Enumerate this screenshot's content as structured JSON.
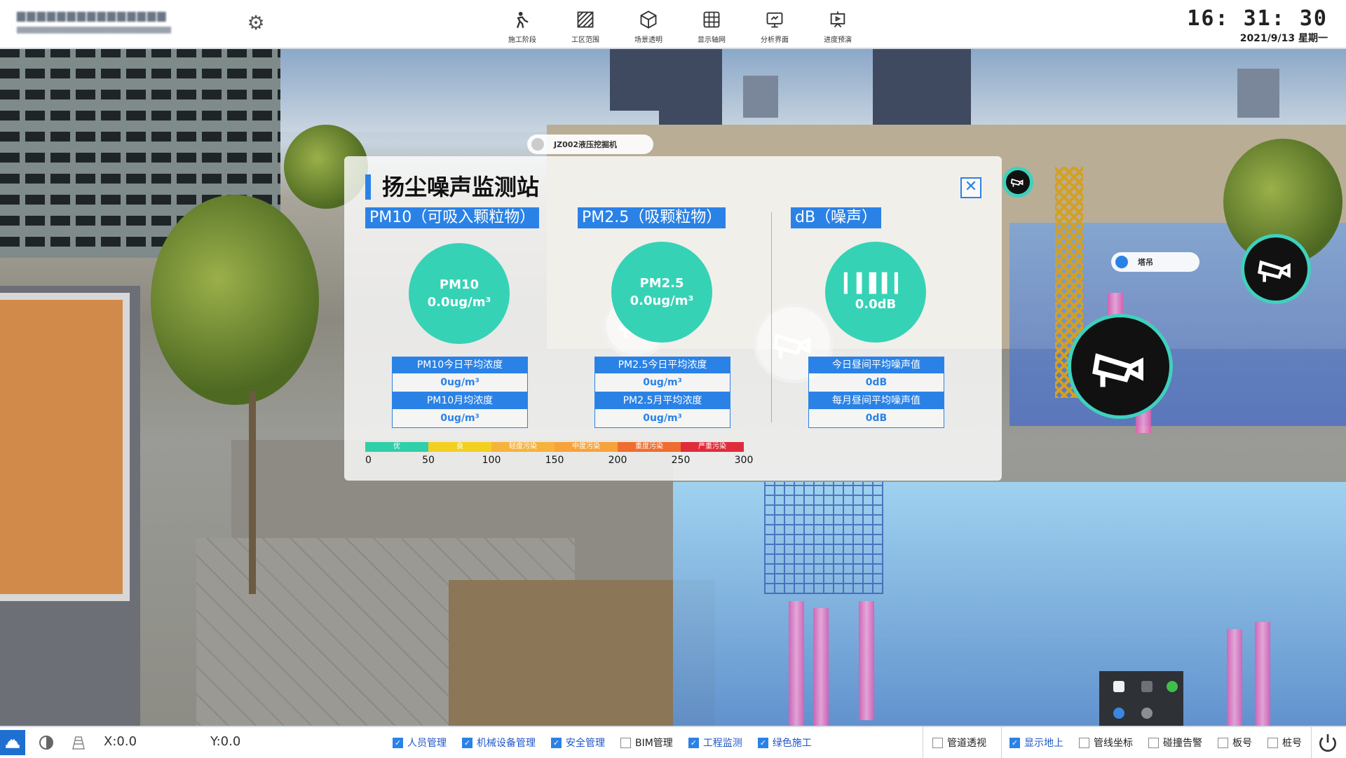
{
  "header": {
    "settings_icon": "gear-icon",
    "nav": [
      {
        "label": "施工阶段",
        "icon": "worker-icon"
      },
      {
        "label": "工区范围",
        "icon": "area-hatch-icon"
      },
      {
        "label": "场景透明",
        "icon": "cube-icon"
      },
      {
        "label": "显示轴网",
        "icon": "grid-icon"
      },
      {
        "label": "分析界面",
        "icon": "monitor-icon"
      },
      {
        "label": "进度预演",
        "icon": "projector-icon"
      }
    ],
    "time": "16: 31: 30",
    "date": "2021/9/13 星期一"
  },
  "scene": {
    "labels": {
      "excavator": "JZ002液压挖掘机",
      "tower_crane": "塔吊"
    }
  },
  "panel": {
    "title": "扬尘噪声监测站",
    "close_icon": "close-icon",
    "sections": [
      {
        "header": "PM10（可吸入颗粒物）",
        "gauge_title": "PM10",
        "gauge_value": "0.0ug/m³",
        "stats": [
          {
            "label": "PM10今日平均浓度",
            "value": "0ug/m³"
          },
          {
            "label": "PM10月均浓度",
            "value": "0ug/m³"
          }
        ]
      },
      {
        "header": "PM2.5（吸颗粒物）",
        "gauge_title": "PM2.5",
        "gauge_value": "0.0ug/m³",
        "stats": [
          {
            "label": "PM2.5今日平均浓度",
            "value": "0ug/m³"
          },
          {
            "label": "PM2.5月平均浓度",
            "value": "0ug/m³"
          }
        ]
      },
      {
        "header": "dB（噪声）",
        "gauge_title": "",
        "gauge_value": "0.0dB",
        "gauge_icon": "sound-wave-icon",
        "stats": [
          {
            "label": "今日昼间平均噪声值",
            "value": "0dB"
          },
          {
            "label": "每月昼间平均噪声值",
            "value": "0dB"
          }
        ]
      }
    ],
    "scale": {
      "bands": [
        {
          "label": "优",
          "color": "#2fcfa9"
        },
        {
          "label": "良",
          "color": "#f3cf22"
        },
        {
          "label": "轻度污染",
          "color": "#f6b33b"
        },
        {
          "label": "中度污染",
          "color": "#f7a33a"
        },
        {
          "label": "重度污染",
          "color": "#ee6d2f"
        },
        {
          "label": "严重污染",
          "color": "#e02c3a"
        }
      ],
      "ticks": [
        "0",
        "50",
        "100",
        "150",
        "200",
        "250",
        "300"
      ]
    }
  },
  "footer": {
    "x_label": "X:0.0",
    "y_label": "Y:0.0",
    "left_icons": [
      "helmet-icon",
      "half-moon-icon",
      "building-wireframe-icon"
    ],
    "checkboxes_a": [
      {
        "label": "人员管理",
        "checked": true
      },
      {
        "label": "机械设备管理",
        "checked": true
      },
      {
        "label": "安全管理",
        "checked": true
      },
      {
        "label": "BIM管理",
        "checked": false
      },
      {
        "label": "工程监测",
        "checked": true
      },
      {
        "label": "绿色施工",
        "checked": true
      }
    ],
    "checkboxes_b": [
      {
        "label": "管道透视",
        "checked": false
      }
    ],
    "checkboxes_c": [
      {
        "label": "显示地上",
        "checked": true
      },
      {
        "label": "管线坐标",
        "checked": false
      },
      {
        "label": "碰撞告警",
        "checked": false
      },
      {
        "label": "板号",
        "checked": false
      },
      {
        "label": "桩号",
        "checked": false
      }
    ],
    "power_icon": "power-icon"
  },
  "colors": {
    "accent": "#2b82e6",
    "gauge": "#36d2b6"
  }
}
